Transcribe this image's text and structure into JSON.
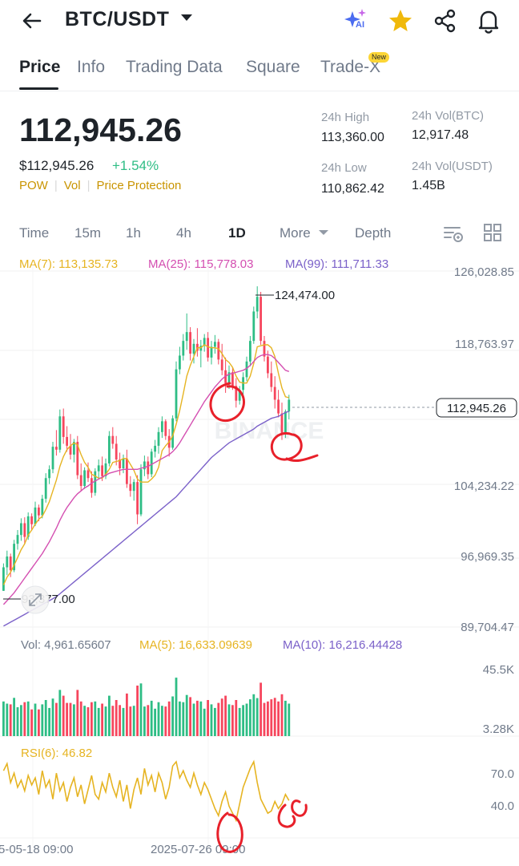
{
  "header": {
    "pair": "BTC/USDT",
    "icons": [
      "back-arrow-icon",
      "ai-sparkle-icon",
      "star-icon",
      "share-icon",
      "bell-icon"
    ],
    "ai_label": "AI"
  },
  "tabs": [
    {
      "label": "Price",
      "active": true
    },
    {
      "label": "Info",
      "active": false
    },
    {
      "label": "Trading Data",
      "active": false
    },
    {
      "label": "Square",
      "active": false
    },
    {
      "label": "Trade-X",
      "active": false
    }
  ],
  "new_badge": "New",
  "ticker": {
    "last_price": "112,945.26",
    "usd_price": "$112,945.26",
    "change": "+1.54%",
    "tags": [
      "POW",
      "Vol",
      "Price Protection"
    ],
    "high_label": "24h High",
    "high_value": "113,360.00",
    "low_label": "24h Low",
    "low_value": "110,862.42",
    "vol_btc_label": "24h Vol(BTC)",
    "vol_btc_value": "12,917.48",
    "vol_usdt_label": "24h Vol(USDT)",
    "vol_usdt_value": "1.45B"
  },
  "timeframes": [
    {
      "label": "Time",
      "active": false
    },
    {
      "label": "15m",
      "active": false
    },
    {
      "label": "1h",
      "active": false
    },
    {
      "label": "4h",
      "active": false
    },
    {
      "label": "1D",
      "active": true
    },
    {
      "label": "More",
      "active": false
    },
    {
      "label": "Depth",
      "active": false
    }
  ],
  "ma_legend": {
    "ma7": "MA(7): 113,135.73",
    "ma25": "MA(25): 115,778.03",
    "ma99": "MA(99): 111,711.33"
  },
  "colors": {
    "up": "#2ebd85",
    "down": "#f6465d",
    "ma7": "#e6b422",
    "ma25": "#d44fb1",
    "ma99": "#7b61c9",
    "accent": "#fcd535",
    "annotation": "#e8202a"
  },
  "chart_data": {
    "type": "candlestick",
    "price_axis_ticks": [
      "126,028.85",
      "118,763.97",
      "104,234.22",
      "96,969.35",
      "89,704.47"
    ],
    "ylim": [
      89704.47,
      126028.85
    ],
    "max_label": "124,474.00",
    "min_label": "93,377.00",
    "current_price_label": "112,945.26",
    "x_tick_labels": [
      "5-05-18 09:00",
      "2025-07-26 09:00"
    ],
    "watermark": "BINANCE",
    "candles": [
      [
        93.4,
        96.2,
        93.4,
        95.8
      ],
      [
        95.8,
        97.5,
        95.0,
        96.9
      ],
      [
        96.9,
        97.2,
        94.8,
        95.5
      ],
      [
        95.5,
        98.6,
        95.3,
        98.2
      ],
      [
        98.2,
        99.6,
        97.6,
        99.1
      ],
      [
        99.1,
        100.8,
        98.5,
        100.3
      ],
      [
        100.3,
        100.9,
        98.2,
        98.9
      ],
      [
        98.9,
        101.4,
        98.6,
        101.0
      ],
      [
        101.0,
        101.3,
        99.6,
        100.2
      ],
      [
        100.2,
        102.5,
        100.0,
        101.9
      ],
      [
        101.9,
        102.2,
        100.5,
        101.1
      ],
      [
        101.1,
        103.2,
        100.8,
        102.8
      ],
      [
        102.8,
        105.4,
        102.4,
        104.9
      ],
      [
        104.9,
        106.2,
        104.3,
        105.8
      ],
      [
        105.8,
        108.6,
        105.4,
        108.1
      ],
      [
        108.1,
        109.8,
        107.2,
        107.8
      ],
      [
        107.8,
        111.9,
        107.5,
        111.2
      ],
      [
        111.2,
        112.0,
        108.4,
        109.1
      ],
      [
        109.1,
        110.2,
        107.6,
        108.2
      ],
      [
        108.2,
        109.4,
        106.8,
        107.3
      ],
      [
        107.3,
        108.9,
        106.5,
        108.6
      ],
      [
        108.6,
        109.2,
        104.8,
        105.2
      ],
      [
        105.2,
        106.4,
        103.6,
        104.1
      ],
      [
        104.1,
        106.0,
        103.8,
        105.7
      ],
      [
        105.7,
        106.5,
        104.5,
        104.9
      ],
      [
        104.9,
        105.6,
        102.9,
        103.4
      ],
      [
        103.4,
        105.9,
        103.1,
        105.6
      ],
      [
        105.6,
        106.8,
        104.9,
        106.2
      ],
      [
        106.2,
        107.1,
        104.6,
        105.1
      ],
      [
        105.1,
        106.9,
        104.8,
        106.4
      ],
      [
        106.4,
        109.7,
        106.1,
        109.2
      ],
      [
        109.2,
        110.1,
        107.9,
        108.4
      ],
      [
        108.4,
        109.2,
        106.2,
        106.8
      ],
      [
        106.8,
        107.5,
        105.2,
        105.9
      ],
      [
        105.9,
        107.3,
        105.4,
        106.9
      ],
      [
        106.9,
        107.8,
        103.9,
        104.3
      ],
      [
        104.3,
        105.1,
        103.0,
        103.6
      ],
      [
        103.6,
        104.8,
        102.6,
        104.5
      ],
      [
        104.5,
        105.2,
        100.2,
        101.2
      ],
      [
        101.2,
        106.3,
        101.0,
        105.8
      ],
      [
        105.8,
        107.2,
        105.1,
        106.6
      ],
      [
        106.6,
        107.1,
        104.8,
        105.3
      ],
      [
        105.3,
        107.9,
        105.0,
        107.6
      ],
      [
        107.6,
        108.8,
        107.0,
        108.2
      ],
      [
        108.2,
        110.1,
        107.4,
        109.6
      ],
      [
        109.6,
        111.2,
        109.0,
        110.7
      ],
      [
        110.7,
        110.9,
        108.8,
        109.2
      ],
      [
        109.2,
        109.9,
        107.1,
        108.0
      ],
      [
        108.0,
        111.3,
        107.8,
        111.0
      ],
      [
        111.0,
        116.8,
        110.7,
        116.0
      ],
      [
        116.0,
        118.3,
        115.5,
        117.4
      ],
      [
        117.4,
        119.6,
        116.9,
        118.9
      ],
      [
        118.9,
        121.7,
        118.0,
        119.8
      ],
      [
        119.8,
        120.3,
        116.9,
        117.6
      ],
      [
        117.6,
        119.1,
        116.6,
        118.6
      ],
      [
        118.6,
        120.2,
        117.3,
        117.9
      ],
      [
        117.9,
        119.0,
        116.2,
        118.4
      ],
      [
        118.4,
        119.6,
        117.8,
        119.2
      ],
      [
        119.2,
        119.8,
        116.8,
        117.2
      ],
      [
        117.2,
        118.9,
        116.5,
        118.3
      ],
      [
        118.3,
        119.5,
        117.6,
        118.8
      ],
      [
        118.8,
        119.1,
        116.5,
        117.0
      ],
      [
        117.0,
        118.6,
        115.4,
        115.9
      ],
      [
        115.9,
        117.2,
        113.6,
        114.6
      ],
      [
        114.6,
        116.4,
        114.0,
        115.7
      ],
      [
        115.7,
        116.2,
        113.9,
        114.3
      ],
      [
        114.3,
        115.1,
        112.1,
        112.8
      ],
      [
        112.8,
        114.3,
        112.4,
        113.9
      ],
      [
        113.9,
        115.7,
        113.4,
        115.2
      ],
      [
        115.2,
        117.3,
        114.8,
        116.8
      ],
      [
        116.8,
        119.4,
        116.3,
        118.9
      ],
      [
        118.9,
        122.4,
        118.6,
        121.9
      ],
      [
        121.9,
        124.47,
        121.2,
        123.4
      ],
      [
        123.4,
        123.9,
        118.5,
        118.9
      ],
      [
        118.9,
        119.4,
        116.8,
        117.3
      ],
      [
        117.3,
        117.9,
        115.1,
        115.6
      ],
      [
        115.6,
        116.8,
        113.7,
        114.2
      ],
      [
        114.2,
        115.3,
        112.0,
        112.9
      ],
      [
        112.9,
        113.9,
        111.1,
        111.5
      ],
      [
        111.5,
        112.6,
        108.8,
        109.4
      ],
      [
        109.4,
        111.9,
        109.0,
        111.7
      ],
      [
        111.7,
        113.4,
        110.9,
        112.9
      ]
    ],
    "ma7": [
      94.0,
      94.8,
      95.3,
      96.0,
      96.8,
      97.6,
      98.2,
      99.1,
      99.6,
      100.2,
      100.7,
      101.0,
      101.7,
      102.5,
      103.6,
      104.7,
      106.1,
      107.1,
      107.8,
      108.2,
      108.5,
      108.3,
      107.3,
      106.5,
      106.0,
      105.3,
      105.1,
      104.9,
      104.9,
      105.3,
      105.8,
      106.5,
      106.6,
      106.7,
      106.9,
      106.9,
      106.3,
      105.7,
      104.8,
      104.5,
      104.5,
      104.5,
      104.8,
      105.2,
      106.0,
      107.7,
      108.2,
      108.6,
      109.2,
      110.4,
      111.8,
      113.5,
      115.3,
      116.4,
      117.3,
      118.2,
      118.2,
      118.5,
      118.3,
      118.2,
      118.2,
      118.1,
      117.6,
      117.0,
      116.7,
      116.2,
      115.3,
      114.7,
      114.6,
      114.6,
      115.3,
      116.6,
      118.3,
      118.4,
      118.5,
      118.5,
      118.2,
      117.3,
      115.6,
      114.1,
      113.2,
      113.1
    ],
    "ma25": [
      92.0,
      92.4,
      92.8,
      93.2,
      93.7,
      94.2,
      94.7,
      95.2,
      95.7,
      96.2,
      96.7,
      97.2,
      97.8,
      98.4,
      99.1,
      99.8,
      100.6,
      101.3,
      101.9,
      102.4,
      102.9,
      103.3,
      103.6,
      103.9,
      104.1,
      104.4,
      104.6,
      104.8,
      105.0,
      105.2,
      105.4,
      105.5,
      105.6,
      105.7,
      105.8,
      105.8,
      105.8,
      105.8,
      105.8,
      105.9,
      106.0,
      106.1,
      106.3,
      106.5,
      106.7,
      106.9,
      107.1,
      107.3,
      107.6,
      108.0,
      108.5,
      109.1,
      109.7,
      110.3,
      110.9,
      111.5,
      112.1,
      112.7,
      113.2,
      113.7,
      114.2,
      114.6,
      115.0,
      115.3,
      115.5,
      115.6,
      115.7,
      115.8,
      115.9,
      116.1,
      116.4,
      116.8,
      117.2,
      117.4,
      117.5,
      117.5,
      117.4,
      117.1,
      116.7,
      116.3,
      115.9,
      115.78
    ],
    "ma99": [
      89.8,
      90.0,
      90.2,
      90.4,
      90.6,
      90.8,
      91.0,
      91.2,
      91.4,
      91.6,
      91.8,
      92.0,
      92.2,
      92.4,
      92.6,
      92.8,
      93.1,
      93.4,
      93.7,
      94.0,
      94.3,
      94.6,
      94.9,
      95.2,
      95.5,
      95.8,
      96.1,
      96.4,
      96.7,
      97.0,
      97.3,
      97.6,
      97.9,
      98.2,
      98.5,
      98.8,
      99.1,
      99.4,
      99.7,
      100.0,
      100.3,
      100.6,
      100.9,
      101.2,
      101.5,
      101.8,
      102.1,
      102.4,
      102.7,
      103.0,
      103.4,
      103.8,
      104.2,
      104.6,
      105.0,
      105.4,
      105.8,
      106.2,
      106.6,
      107.0,
      107.3,
      107.6,
      107.9,
      108.2,
      108.5,
      108.7,
      108.9,
      109.1,
      109.3,
      109.5,
      109.7,
      109.9,
      110.2,
      110.4,
      110.6,
      110.8,
      111.0,
      111.1,
      111.2,
      111.4,
      111.6,
      111.71
    ],
    "volume_legend": {
      "vol": "Vol: 4,961.65607",
      "ma5": "MA(5): 16,633.09639",
      "ma10": "MA(10): 16,216.44428"
    },
    "volume_axis_ticks": [
      "45.5K",
      "3.28K"
    ],
    "rsi_legend": "RSI(6): 46.82",
    "rsi_axis_ticks": [
      "70.0",
      "40.0"
    ],
    "rsi": [
      72,
      78,
      62,
      70,
      58,
      64,
      55,
      68,
      60,
      66,
      52,
      72,
      58,
      64,
      48,
      70,
      55,
      62,
      46,
      58,
      66,
      50,
      60,
      44,
      56,
      68,
      52,
      48,
      62,
      54,
      70,
      58,
      50,
      64,
      46,
      60,
      40,
      56,
      66,
      52,
      74,
      60,
      68,
      54,
      70,
      62,
      48,
      58,
      76,
      80,
      66,
      72,
      64,
      58,
      70,
      60,
      52,
      62,
      56,
      48,
      40,
      34,
      46,
      54,
      42,
      36,
      30,
      44,
      58,
      66,
      74,
      80,
      62,
      48,
      42,
      36,
      38,
      46,
      40,
      44,
      52,
      46.82
    ],
    "annotations": "red hand-drawn circles and Q-shaped marks near recent lows"
  }
}
